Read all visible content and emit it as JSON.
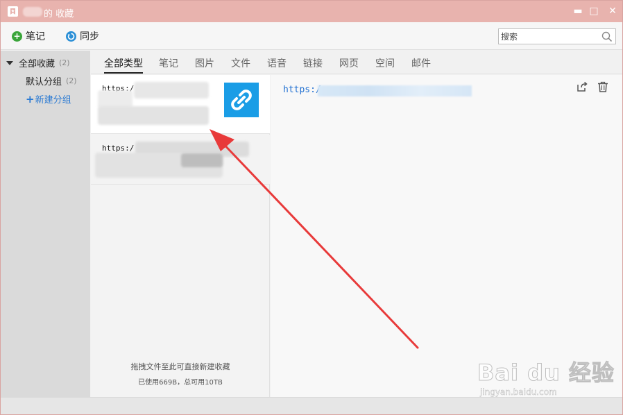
{
  "window": {
    "title": "的 收藏",
    "minimize": "▬",
    "maximize": "□",
    "close": "✕"
  },
  "toolbar": {
    "note_label": "笔记",
    "sync_label": "同步",
    "search_placeholder": "搜索"
  },
  "sidebar": {
    "all_label": "全部收藏",
    "all_count": "(2)",
    "default_label": "默认分组",
    "default_count": "(2)",
    "new_group_label": "新建分组"
  },
  "tabs": [
    "全部类型",
    "笔记",
    "图片",
    "文件",
    "语音",
    "链接",
    "网页",
    "空间",
    "邮件"
  ],
  "list": {
    "items": [
      {
        "url": "https:/"
      },
      {
        "url": "https:/"
      }
    ],
    "drop_hint": "拖拽文件至此可直接新建收藏",
    "usage": "已使用669B，总可用10TB"
  },
  "detail": {
    "url": "https:/"
  },
  "watermark": {
    "main": "Bai du 经验",
    "sub": "jingyan.baidu.com"
  },
  "colors": {
    "titlebar": "#e8b3ae",
    "link_thumb": "#1a9de6",
    "accent_link": "#2a7ad3",
    "arrow": "#e83a3a"
  }
}
